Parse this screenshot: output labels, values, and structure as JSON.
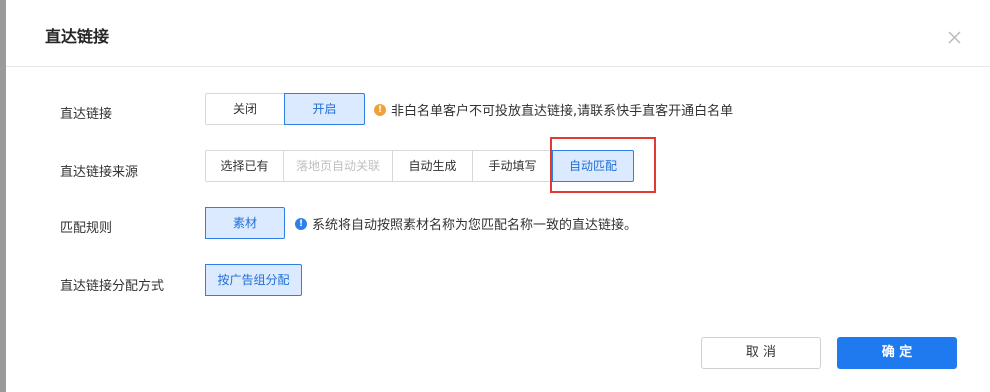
{
  "dialog": {
    "title": "直达链接",
    "close_icon": "close-icon"
  },
  "rows": {
    "link": {
      "label": "直达链接",
      "options": [
        "关闭",
        "开启"
      ],
      "selected": "开启",
      "hint": "非白名单客户不可投放直达链接,请联系快手直客开通白名单"
    },
    "source": {
      "label": "直达链接来源",
      "options": [
        "选择已有",
        "落地页自动关联",
        "自动生成",
        "手动填写",
        "自动匹配"
      ],
      "disabled": [
        "落地页自动关联"
      ],
      "selected": "自动匹配"
    },
    "rule": {
      "label": "匹配规则",
      "options": [
        "素材"
      ],
      "selected": "素材",
      "hint": "系统将自动按照素材名称为您匹配名称一致的直达链接。"
    },
    "allocation": {
      "label": "直达链接分配方式",
      "options": [
        "按广告组分配"
      ],
      "selected": "按广告组分配"
    }
  },
  "footer": {
    "cancel_label": "取 消",
    "ok_label": "确 定"
  },
  "colors": {
    "accent": "#1f7af0",
    "selected_bg": "#dbeaff",
    "highlight_border": "#e23a32",
    "warn_icon": "#f0a23a"
  }
}
